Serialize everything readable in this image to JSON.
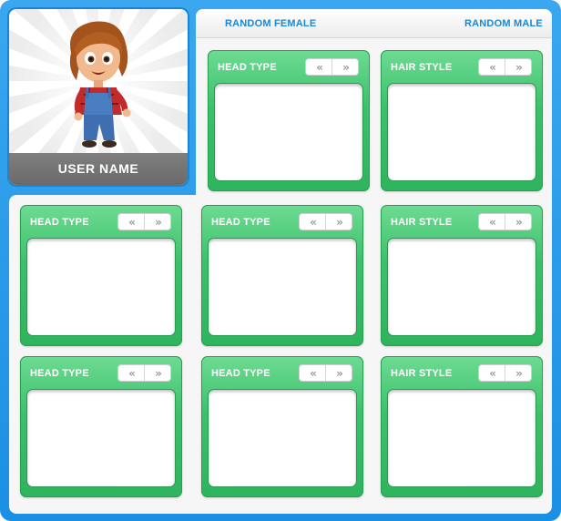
{
  "header": {
    "random_female": "RANDOM FEMALE",
    "random_male": "RANDOM MALE"
  },
  "avatar": {
    "username": "USER NAME"
  },
  "panels": [
    {
      "title": "HEAD TYPE"
    },
    {
      "title": "HAIR STYLE"
    },
    {
      "title": "HEAD TYPE"
    },
    {
      "title": "HEAD TYPE"
    },
    {
      "title": "HAIR STYLE"
    },
    {
      "title": "HEAD TYPE"
    },
    {
      "title": "HEAD TYPE"
    },
    {
      "title": "HAIR STYLE"
    }
  ],
  "arrows": {
    "prev": "«",
    "next": "»"
  },
  "colors": {
    "frame_blue": "#1b8fe3",
    "panel_green": "#3cc16b",
    "link_blue": "#1a88d6",
    "username_bar": "#6a6a6a"
  },
  "icons": {
    "prev": "double-chevron-left-icon",
    "next": "double-chevron-right-icon"
  }
}
